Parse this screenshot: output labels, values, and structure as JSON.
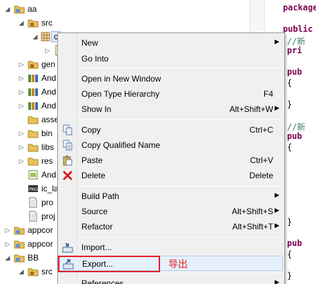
{
  "tree": {
    "items": [
      {
        "label": "aa",
        "icon": "project-icon"
      },
      {
        "label": "src",
        "icon": "source-folder-icon"
      },
      {
        "label": "c",
        "icon": "package-icon"
      },
      {
        "label": "",
        "icon": "java-file-icon"
      },
      {
        "label": "gen",
        "icon": "source-folder-icon"
      },
      {
        "label": "And",
        "icon": "android-library-icon"
      },
      {
        "label": "And",
        "icon": "android-library-icon"
      },
      {
        "label": "And",
        "icon": "android-library-icon"
      },
      {
        "label": "asse",
        "icon": "folder-icon"
      },
      {
        "label": "bin",
        "icon": "folder-icon"
      },
      {
        "label": "libs",
        "icon": "folder-icon"
      },
      {
        "label": "res",
        "icon": "folder-icon"
      },
      {
        "label": "And",
        "icon": "manifest-file-icon"
      },
      {
        "label": "ic_la",
        "icon": "png-file-icon"
      },
      {
        "label": "pro",
        "icon": "text-file-icon"
      },
      {
        "label": "proj",
        "icon": "text-file-icon"
      },
      {
        "label": "appcor",
        "icon": "project-icon"
      },
      {
        "label": "appcor",
        "icon": "project-icon"
      },
      {
        "label": "BB",
        "icon": "project-icon"
      },
      {
        "label": "src",
        "icon": "source-folder-icon"
      }
    ]
  },
  "editor": {
    "lines": [
      {
        "text": "package",
        "kind": "kw"
      },
      {
        "text": "",
        "kind": "pl"
      },
      {
        "text": "public c",
        "kind": "kw"
      },
      {
        "text": "//新",
        "kind": "cm"
      },
      {
        "text": "pri",
        "kind": "kw"
      },
      {
        "text": "",
        "kind": "pl"
      },
      {
        "text": "pub",
        "kind": "kw"
      },
      {
        "text": "{",
        "kind": "pl"
      },
      {
        "text": "",
        "kind": "pl"
      },
      {
        "text": "}",
        "kind": "pl"
      },
      {
        "text": "",
        "kind": "pl"
      },
      {
        "text": "//新",
        "kind": "cm"
      },
      {
        "text": "pub",
        "kind": "kw"
      },
      {
        "text": "{",
        "kind": "pl"
      },
      {
        "text": "",
        "kind": "pl"
      },
      {
        "text": "",
        "kind": "pl"
      },
      {
        "text": "",
        "kind": "pl"
      },
      {
        "text": "",
        "kind": "pl"
      },
      {
        "text": "",
        "kind": "pl"
      },
      {
        "text": "",
        "kind": "pl"
      },
      {
        "text": "}",
        "kind": "pl"
      },
      {
        "text": "",
        "kind": "pl"
      },
      {
        "text": "pub",
        "kind": "kw"
      },
      {
        "text": "{",
        "kind": "pl"
      },
      {
        "text": "",
        "kind": "pl"
      },
      {
        "text": "}",
        "kind": "pl"
      }
    ]
  },
  "menu": {
    "new": {
      "label": "New"
    },
    "go_into": {
      "label": "Go Into"
    },
    "open_new_window": {
      "label": "Open in New Window"
    },
    "open_type_hierarchy": {
      "label": "Open Type Hierarchy",
      "shortcut": "F4"
    },
    "show_in": {
      "label": "Show In",
      "shortcut": "Alt+Shift+W"
    },
    "copy": {
      "label": "Copy",
      "shortcut": "Ctrl+C"
    },
    "copy_qualified": {
      "label": "Copy Qualified Name"
    },
    "paste": {
      "label": "Paste",
      "shortcut": "Ctrl+V"
    },
    "delete": {
      "label": "Delete",
      "shortcut": "Delete"
    },
    "build_path": {
      "label": "Build Path"
    },
    "source": {
      "label": "Source",
      "shortcut": "Alt+Shift+S"
    },
    "refactor": {
      "label": "Refactor",
      "shortcut": "Alt+Shift+T"
    },
    "import": {
      "label": "Import..."
    },
    "export": {
      "label": "Export..."
    },
    "references": {
      "label": "References"
    }
  },
  "annotation": {
    "text": "导出",
    "color": "#e81e25"
  }
}
